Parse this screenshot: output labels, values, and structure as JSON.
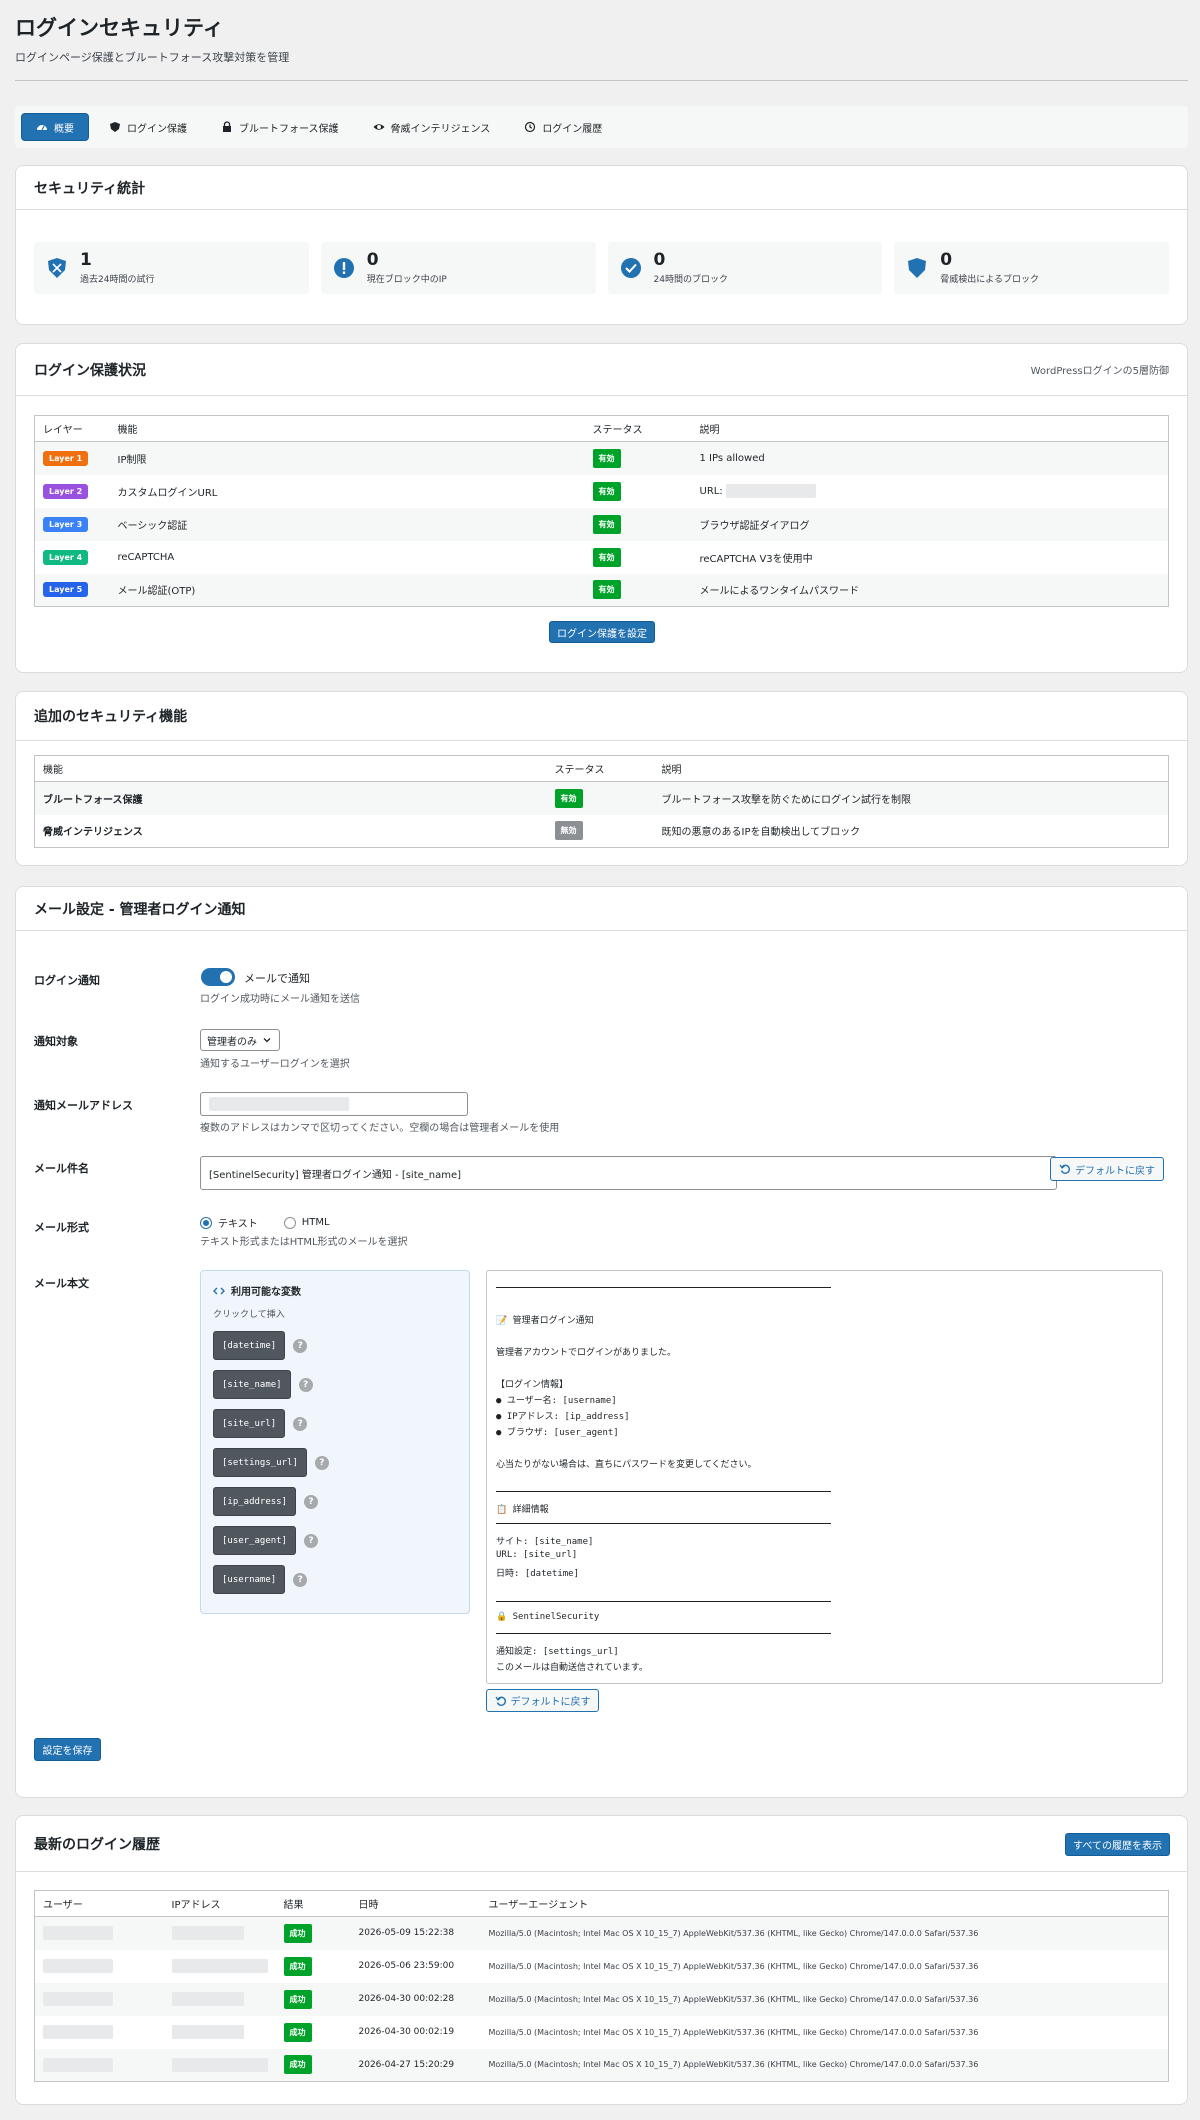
{
  "header": {
    "title": "ログインセキュリティ",
    "subtitle": "ログインページ保護とブルートフォース攻撃対策を管理"
  },
  "tabs": [
    {
      "label": "概要"
    },
    {
      "label": "ログイン保護"
    },
    {
      "label": "ブルートフォース保護"
    },
    {
      "label": "脅威インテリジェンス"
    },
    {
      "label": "ログイン履歴"
    }
  ],
  "stats_card": {
    "title": "セキュリティ統計",
    "items": [
      {
        "value": "1",
        "label": "過去24時間の試行"
      },
      {
        "value": "0",
        "label": "現在ブロック中のIP"
      },
      {
        "value": "0",
        "label": "24時間のブロック"
      },
      {
        "value": "0",
        "label": "脅威検出によるブロック"
      }
    ]
  },
  "login_protection": {
    "title": "ログイン保護状況",
    "aside": "WordPressログインの5層防御",
    "headers": [
      "レイヤー",
      "機能",
      "ステータス",
      "説明"
    ],
    "rows": [
      {
        "layer": "Layer 1",
        "color": "#f0700f",
        "feature": "IP制限",
        "status": "有効",
        "desc": "1 IPs allowed"
      },
      {
        "layer": "Layer 2",
        "color": "#9b51e0",
        "feature": "カスタムログインURL",
        "status": "有効",
        "desc": "URL:"
      },
      {
        "layer": "Layer 3",
        "color": "#3b82f6",
        "feature": "ベーシック認証",
        "status": "有効",
        "desc": "ブラウザ認証ダイアログ"
      },
      {
        "layer": "Layer 4",
        "color": "#10b981",
        "feature": "reCAPTCHA",
        "status": "有効",
        "desc": "reCAPTCHA V3を使用中"
      },
      {
        "layer": "Layer 5",
        "color": "#2563eb",
        "feature": "メール認証(OTP)",
        "status": "有効",
        "desc": "メールによるワンタイムパスワード"
      }
    ],
    "button": "ログイン保護を設定"
  },
  "additional": {
    "title": "追加のセキュリティ機能",
    "headers": [
      "機能",
      "ステータス",
      "説明"
    ],
    "rows": [
      {
        "feature": "ブルートフォース保護",
        "status": "有効",
        "desc": "ブルートフォース攻撃を防ぐためにログイン試行を制限"
      },
      {
        "feature": "脅威インテリジェンス",
        "status": "無効",
        "desc": "既知の悪意のあるIPを自動検出してブロック"
      }
    ]
  },
  "email": {
    "title": "メール設定 - 管理者ログイン通知",
    "notify_label": "ログイン通知",
    "notify_toggle_label": "メールで通知",
    "notify_help": "ログイン成功時にメール通知を送信",
    "target_label": "通知対象",
    "target_value": "管理者のみ",
    "target_help": "通知するユーザーログインを選択",
    "address_label": "通知メールアドレス",
    "address_help": "複数のアドレスはカンマで区切ってください。空欄の場合は管理者メールを使用",
    "subject_label": "メール件名",
    "subject_value": "[SentinelSecurity] 管理者ログイン通知 - [site_name]",
    "reset_label": "デフォルトに戻す",
    "format_label": "メール形式",
    "format_text": "テキスト",
    "format_html": "HTML",
    "format_help": "テキスト形式またはHTML形式のメールを選択",
    "body_label": "メール本文",
    "vars_title": "利用可能な変数",
    "vars_help": "クリックして挿入",
    "vars": [
      "[datetime]",
      "[site_name]",
      "[site_url]",
      "[settings_url]",
      "[ip_address]",
      "[user_agent]",
      "[username]"
    ],
    "body_lines": {
      "l1": "管理者ログイン通知",
      "l2": "管理者アカウントでログインがありました。",
      "l3": "【ログイン情報】",
      "l4": "● ユーザー名: [username]",
      "l5": "● IPアドレス: [ip_address]",
      "l6": "● ブラウザ: [user_agent]",
      "l7": "心当たりがない場合は、直ちにパスワードを変更してください。",
      "l8": "詳細情報",
      "l9": "サイト: [site_name]",
      "l10": "URL: [site_url]",
      "l11": "日時: [datetime]",
      "l12": "SentinelSecurity",
      "l13": "通知設定: [settings_url]",
      "l14": "このメールは自動送信されています。"
    },
    "save_label": "設定を保存"
  },
  "history": {
    "title": "最新のログイン履歴",
    "view_all": "すべての履歴を表示",
    "headers": [
      "ユーザー",
      "IPアドレス",
      "結果",
      "日時",
      "ユーザーエージェント"
    ],
    "rows": [
      {
        "result": "成功",
        "date": "2026-05-09 15:22:38",
        "ua": "Mozilla/5.0 (Macintosh; Intel Mac OS X 10_15_7) AppleWebKit/537.36 (KHTML, like Gecko) Chrome/147.0.0.0 Safari/537.36"
      },
      {
        "result": "成功",
        "date": "2026-05-06 23:59:00",
        "ua": "Mozilla/5.0 (Macintosh; Intel Mac OS X 10_15_7) AppleWebKit/537.36 (KHTML, like Gecko) Chrome/147.0.0.0 Safari/537.36"
      },
      {
        "result": "成功",
        "date": "2026-04-30 00:02:28",
        "ua": "Mozilla/5.0 (Macintosh; Intel Mac OS X 10_15_7) AppleWebKit/537.36 (KHTML, like Gecko) Chrome/147.0.0.0 Safari/537.36"
      },
      {
        "result": "成功",
        "date": "2026-04-30 00:02:19",
        "ua": "Mozilla/5.0 (Macintosh; Intel Mac OS X 10_15_7) AppleWebKit/537.36 (KHTML, like Gecko) Chrome/147.0.0.0 Safari/537.36"
      },
      {
        "result": "成功",
        "date": "2026-04-27 15:20:29",
        "ua": "Mozilla/5.0 (Macintosh; Intel Mac OS X 10_15_7) AppleWebKit/537.36 (KHTML, like Gecko) Chrome/147.0.0.0 Safari/537.36"
      }
    ]
  },
  "colors": {
    "accent": "#2271b1",
    "success": "#00a32a",
    "disabled": "#8c8f94"
  }
}
